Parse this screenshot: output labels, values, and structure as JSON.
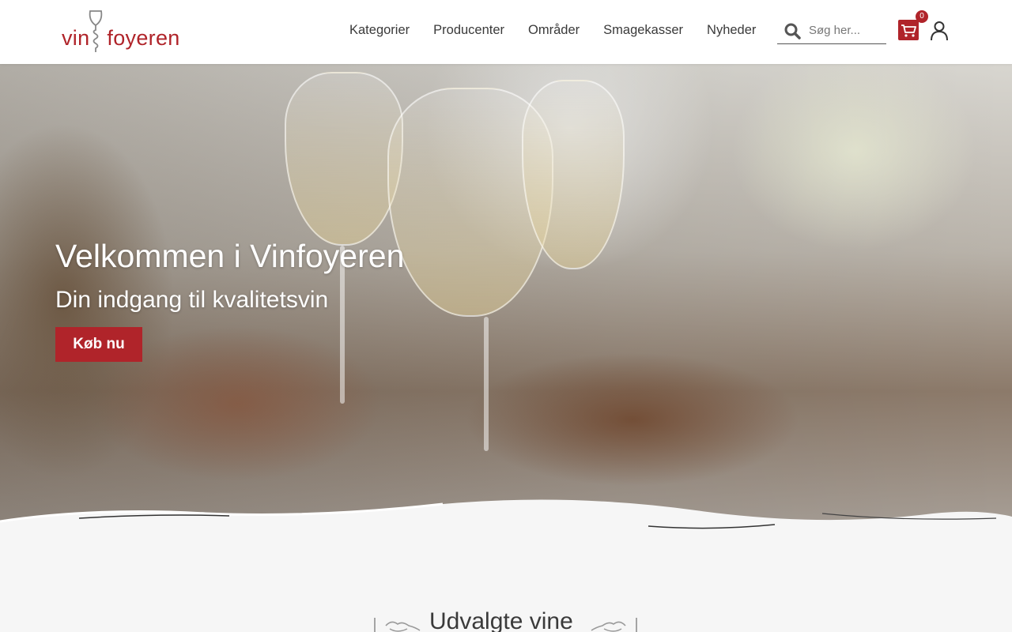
{
  "header": {
    "logo": {
      "part1": "vin",
      "part2": "foyeren"
    },
    "nav": [
      {
        "label": "Kategorier"
      },
      {
        "label": "Producenter"
      },
      {
        "label": "Områder"
      },
      {
        "label": "Smagekasser"
      },
      {
        "label": "Nyheder"
      }
    ],
    "search": {
      "placeholder": "Søg her..."
    },
    "cart": {
      "count": "0"
    }
  },
  "hero": {
    "title": "Velkommen i Vinfoyeren",
    "subtitle": "Din indgang til kvalitetsvin",
    "button_label": "Køb nu"
  },
  "section": {
    "title": "Udvalgte vine"
  },
  "colors": {
    "brand": "#b0242a",
    "background": "#f6f6f6",
    "text": "#3a3a3a"
  },
  "icons": {
    "search": "search-icon",
    "cart": "cart-icon",
    "account": "user-icon"
  }
}
